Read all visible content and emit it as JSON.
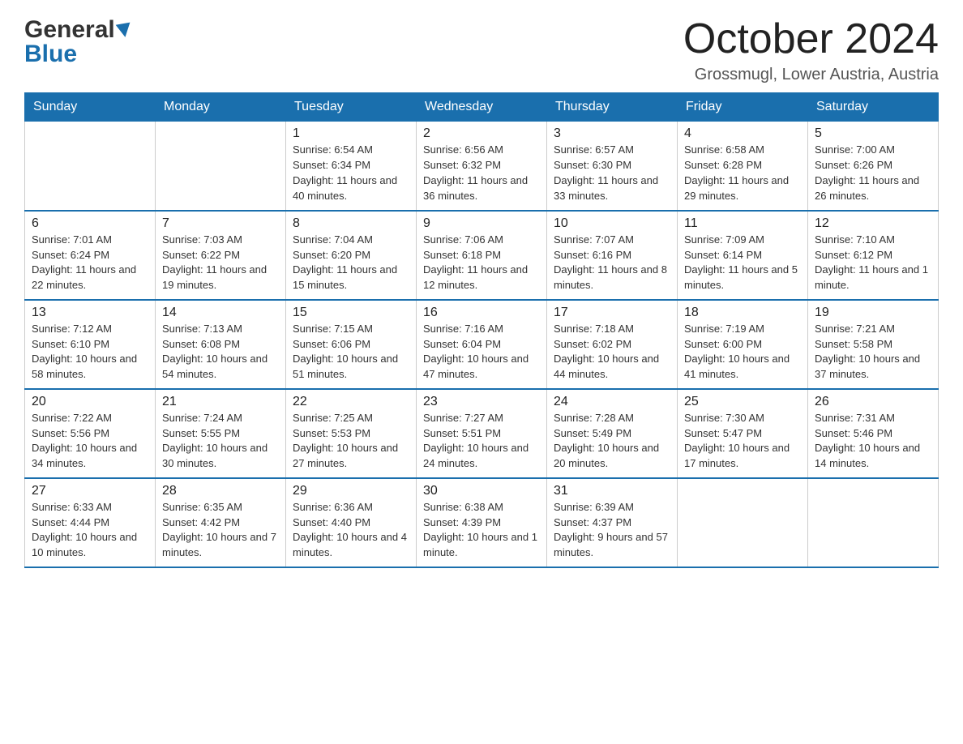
{
  "logo": {
    "general": "General",
    "blue": "Blue"
  },
  "title": "October 2024",
  "location": "Grossmugl, Lower Austria, Austria",
  "headers": [
    "Sunday",
    "Monday",
    "Tuesday",
    "Wednesday",
    "Thursday",
    "Friday",
    "Saturday"
  ],
  "weeks": [
    [
      {
        "day": "",
        "sunrise": "",
        "sunset": "",
        "daylight": ""
      },
      {
        "day": "",
        "sunrise": "",
        "sunset": "",
        "daylight": ""
      },
      {
        "day": "1",
        "sunrise": "Sunrise: 6:54 AM",
        "sunset": "Sunset: 6:34 PM",
        "daylight": "Daylight: 11 hours and 40 minutes."
      },
      {
        "day": "2",
        "sunrise": "Sunrise: 6:56 AM",
        "sunset": "Sunset: 6:32 PM",
        "daylight": "Daylight: 11 hours and 36 minutes."
      },
      {
        "day": "3",
        "sunrise": "Sunrise: 6:57 AM",
        "sunset": "Sunset: 6:30 PM",
        "daylight": "Daylight: 11 hours and 33 minutes."
      },
      {
        "day": "4",
        "sunrise": "Sunrise: 6:58 AM",
        "sunset": "Sunset: 6:28 PM",
        "daylight": "Daylight: 11 hours and 29 minutes."
      },
      {
        "day": "5",
        "sunrise": "Sunrise: 7:00 AM",
        "sunset": "Sunset: 6:26 PM",
        "daylight": "Daylight: 11 hours and 26 minutes."
      }
    ],
    [
      {
        "day": "6",
        "sunrise": "Sunrise: 7:01 AM",
        "sunset": "Sunset: 6:24 PM",
        "daylight": "Daylight: 11 hours and 22 minutes."
      },
      {
        "day": "7",
        "sunrise": "Sunrise: 7:03 AM",
        "sunset": "Sunset: 6:22 PM",
        "daylight": "Daylight: 11 hours and 19 minutes."
      },
      {
        "day": "8",
        "sunrise": "Sunrise: 7:04 AM",
        "sunset": "Sunset: 6:20 PM",
        "daylight": "Daylight: 11 hours and 15 minutes."
      },
      {
        "day": "9",
        "sunrise": "Sunrise: 7:06 AM",
        "sunset": "Sunset: 6:18 PM",
        "daylight": "Daylight: 11 hours and 12 minutes."
      },
      {
        "day": "10",
        "sunrise": "Sunrise: 7:07 AM",
        "sunset": "Sunset: 6:16 PM",
        "daylight": "Daylight: 11 hours and 8 minutes."
      },
      {
        "day": "11",
        "sunrise": "Sunrise: 7:09 AM",
        "sunset": "Sunset: 6:14 PM",
        "daylight": "Daylight: 11 hours and 5 minutes."
      },
      {
        "day": "12",
        "sunrise": "Sunrise: 7:10 AM",
        "sunset": "Sunset: 6:12 PM",
        "daylight": "Daylight: 11 hours and 1 minute."
      }
    ],
    [
      {
        "day": "13",
        "sunrise": "Sunrise: 7:12 AM",
        "sunset": "Sunset: 6:10 PM",
        "daylight": "Daylight: 10 hours and 58 minutes."
      },
      {
        "day": "14",
        "sunrise": "Sunrise: 7:13 AM",
        "sunset": "Sunset: 6:08 PM",
        "daylight": "Daylight: 10 hours and 54 minutes."
      },
      {
        "day": "15",
        "sunrise": "Sunrise: 7:15 AM",
        "sunset": "Sunset: 6:06 PM",
        "daylight": "Daylight: 10 hours and 51 minutes."
      },
      {
        "day": "16",
        "sunrise": "Sunrise: 7:16 AM",
        "sunset": "Sunset: 6:04 PM",
        "daylight": "Daylight: 10 hours and 47 minutes."
      },
      {
        "day": "17",
        "sunrise": "Sunrise: 7:18 AM",
        "sunset": "Sunset: 6:02 PM",
        "daylight": "Daylight: 10 hours and 44 minutes."
      },
      {
        "day": "18",
        "sunrise": "Sunrise: 7:19 AM",
        "sunset": "Sunset: 6:00 PM",
        "daylight": "Daylight: 10 hours and 41 minutes."
      },
      {
        "day": "19",
        "sunrise": "Sunrise: 7:21 AM",
        "sunset": "Sunset: 5:58 PM",
        "daylight": "Daylight: 10 hours and 37 minutes."
      }
    ],
    [
      {
        "day": "20",
        "sunrise": "Sunrise: 7:22 AM",
        "sunset": "Sunset: 5:56 PM",
        "daylight": "Daylight: 10 hours and 34 minutes."
      },
      {
        "day": "21",
        "sunrise": "Sunrise: 7:24 AM",
        "sunset": "Sunset: 5:55 PM",
        "daylight": "Daylight: 10 hours and 30 minutes."
      },
      {
        "day": "22",
        "sunrise": "Sunrise: 7:25 AM",
        "sunset": "Sunset: 5:53 PM",
        "daylight": "Daylight: 10 hours and 27 minutes."
      },
      {
        "day": "23",
        "sunrise": "Sunrise: 7:27 AM",
        "sunset": "Sunset: 5:51 PM",
        "daylight": "Daylight: 10 hours and 24 minutes."
      },
      {
        "day": "24",
        "sunrise": "Sunrise: 7:28 AM",
        "sunset": "Sunset: 5:49 PM",
        "daylight": "Daylight: 10 hours and 20 minutes."
      },
      {
        "day": "25",
        "sunrise": "Sunrise: 7:30 AM",
        "sunset": "Sunset: 5:47 PM",
        "daylight": "Daylight: 10 hours and 17 minutes."
      },
      {
        "day": "26",
        "sunrise": "Sunrise: 7:31 AM",
        "sunset": "Sunset: 5:46 PM",
        "daylight": "Daylight: 10 hours and 14 minutes."
      }
    ],
    [
      {
        "day": "27",
        "sunrise": "Sunrise: 6:33 AM",
        "sunset": "Sunset: 4:44 PM",
        "daylight": "Daylight: 10 hours and 10 minutes."
      },
      {
        "day": "28",
        "sunrise": "Sunrise: 6:35 AM",
        "sunset": "Sunset: 4:42 PM",
        "daylight": "Daylight: 10 hours and 7 minutes."
      },
      {
        "day": "29",
        "sunrise": "Sunrise: 6:36 AM",
        "sunset": "Sunset: 4:40 PM",
        "daylight": "Daylight: 10 hours and 4 minutes."
      },
      {
        "day": "30",
        "sunrise": "Sunrise: 6:38 AM",
        "sunset": "Sunset: 4:39 PM",
        "daylight": "Daylight: 10 hours and 1 minute."
      },
      {
        "day": "31",
        "sunrise": "Sunrise: 6:39 AM",
        "sunset": "Sunset: 4:37 PM",
        "daylight": "Daylight: 9 hours and 57 minutes."
      },
      {
        "day": "",
        "sunrise": "",
        "sunset": "",
        "daylight": ""
      },
      {
        "day": "",
        "sunrise": "",
        "sunset": "",
        "daylight": ""
      }
    ]
  ]
}
